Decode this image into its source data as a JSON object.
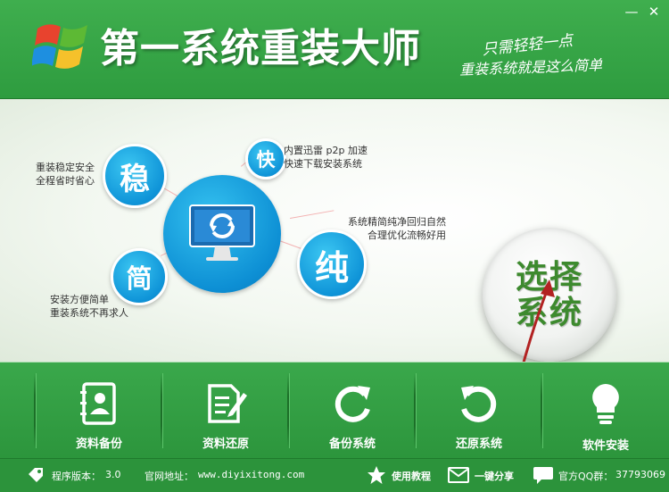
{
  "header": {
    "title": "第一系统重装大师",
    "slogan_line1": "只需轻轻一点",
    "slogan_line2": "重装系统就是这么简单",
    "minimize_icon": "minimize-icon",
    "close_icon": "close-icon"
  },
  "features": {
    "wen": {
      "char": "稳",
      "line1": "重装稳定安全",
      "line2": "全程省时省心"
    },
    "kuai": {
      "char": "快",
      "line1": "内置迅雷 p2p 加速",
      "line2": "快速下载安装系统"
    },
    "chun": {
      "char": "纯",
      "line1": "系统精简纯净回归自然",
      "line2": "合理优化流畅好用"
    },
    "jian": {
      "char": "简",
      "line1": "安装方便简单",
      "line2": "重装系统不再求人"
    }
  },
  "select_button": {
    "line1": "选择",
    "line2": "系统"
  },
  "toolbar": {
    "items": [
      {
        "label": "资料备份",
        "icon": "contacts-book-icon"
      },
      {
        "label": "资料还原",
        "icon": "document-edit-icon"
      },
      {
        "label": "备份系统",
        "icon": "refresh-icon"
      },
      {
        "label": "还原系统",
        "icon": "restore-icon"
      },
      {
        "label": "软件安装",
        "icon": "lightbulb-icon"
      }
    ]
  },
  "status": {
    "version_label": "程序版本：",
    "version": "3.0",
    "site_label": "官网地址：",
    "site": "www.diyixitong.com",
    "tutorial": "使用教程",
    "share": "一键分享",
    "qq_label": "官方QQ群：",
    "qq": "37793069"
  },
  "colors": {
    "brand_green": "#2e9c3f",
    "accent_blue": "#1aa0e0",
    "arrow_red": "#b22222"
  }
}
